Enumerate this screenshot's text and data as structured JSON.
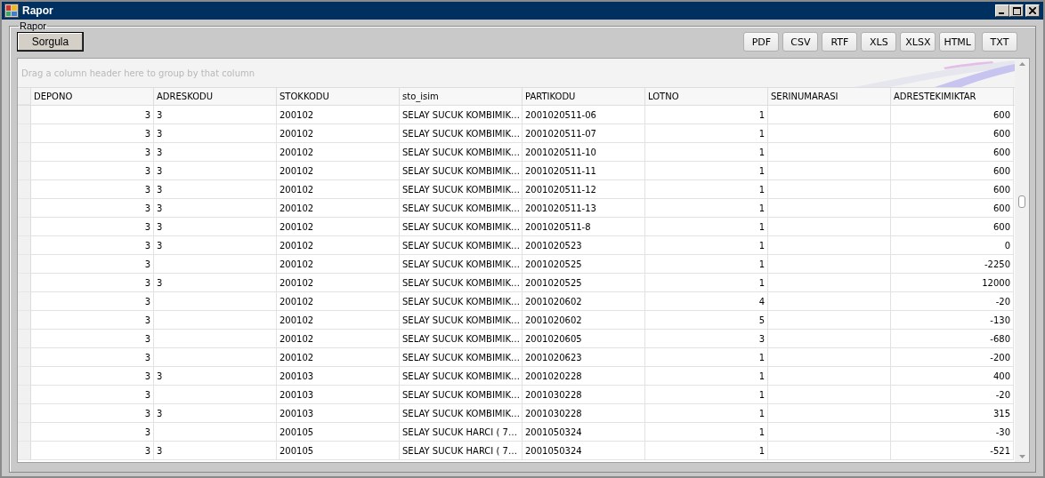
{
  "window": {
    "title": "Rapor"
  },
  "group": {
    "title": "Rapor"
  },
  "query_button": "Sorgula",
  "export_buttons": [
    "PDF",
    "CSV",
    "RTF",
    "XLS",
    "XLSX",
    "HTML",
    "TXT"
  ],
  "grid": {
    "group_panel_hint": "Drag a column header here to group by that column",
    "columns": [
      "DEPONO",
      "ADRESKODU",
      "STOKKODU",
      "sto_isim",
      "PARTIKODU",
      "LOTNO",
      "SERINUMARASI",
      "ADRESTEKIMIKTAR"
    ],
    "rows": [
      [
        "3",
        "3",
        "200102",
        "SELAY SUCUK KOMBIMIK…",
        "2001020511-06",
        "1",
        null,
        "600"
      ],
      [
        "3",
        "3",
        "200102",
        "SELAY SUCUK KOMBIMIK…",
        "2001020511-07",
        "1",
        null,
        "600"
      ],
      [
        "3",
        "3",
        "200102",
        "SELAY SUCUK KOMBIMIK…",
        "2001020511-10",
        "1",
        null,
        "600"
      ],
      [
        "3",
        "3",
        "200102",
        "SELAY SUCUK KOMBIMIK…",
        "2001020511-11",
        "1",
        null,
        "600"
      ],
      [
        "3",
        "3",
        "200102",
        "SELAY SUCUK KOMBIMIK…",
        "2001020511-12",
        "1",
        null,
        "600"
      ],
      [
        "3",
        "3",
        "200102",
        "SELAY SUCUK KOMBIMIK…",
        "2001020511-13",
        "1",
        null,
        "600"
      ],
      [
        "3",
        "3",
        "200102",
        "SELAY SUCUK KOMBIMIK…",
        "2001020511-8",
        "1",
        null,
        "600"
      ],
      [
        "3",
        "3",
        "200102",
        "SELAY SUCUK KOMBIMIK…",
        "2001020523",
        "1",
        null,
        "0"
      ],
      [
        "3",
        null,
        "200102",
        "SELAY SUCUK KOMBIMIK…",
        "2001020525",
        "1",
        null,
        "-2250"
      ],
      [
        "3",
        "3",
        "200102",
        "SELAY SUCUK KOMBIMIK…",
        "2001020525",
        "1",
        null,
        "12000"
      ],
      [
        "3",
        null,
        "200102",
        "SELAY SUCUK KOMBIMIK…",
        "2001020602",
        "4",
        null,
        "-20"
      ],
      [
        "3",
        null,
        "200102",
        "SELAY SUCUK KOMBIMIK…",
        "2001020602",
        "5",
        null,
        "-130"
      ],
      [
        "3",
        null,
        "200102",
        "SELAY SUCUK KOMBIMIK…",
        "2001020605",
        "3",
        null,
        "-680"
      ],
      [
        "3",
        null,
        "200102",
        "SELAY SUCUK KOMBIMIK…",
        "2001020623",
        "1",
        null,
        "-200"
      ],
      [
        "3",
        "3",
        "200103",
        "SELAY SUCUK KOMBIMIK…",
        "2001020228",
        "1",
        null,
        "400"
      ],
      [
        "3",
        null,
        "200103",
        "SELAY SUCUK KOMBIMIK…",
        "2001030228",
        "1",
        null,
        "-20"
      ],
      [
        "3",
        "3",
        "200103",
        "SELAY SUCUK KOMBIMIK…",
        "2001030228",
        "1",
        null,
        "315"
      ],
      [
        "3",
        null,
        "200105",
        "SELAY SUCUK HARCI ( 7…",
        "2001050324",
        "1",
        null,
        "-30"
      ],
      [
        "3",
        "3",
        "200105",
        "SELAY SUCUK HARCI ( 7…",
        "2001050324",
        "1",
        null,
        "-521"
      ]
    ]
  }
}
